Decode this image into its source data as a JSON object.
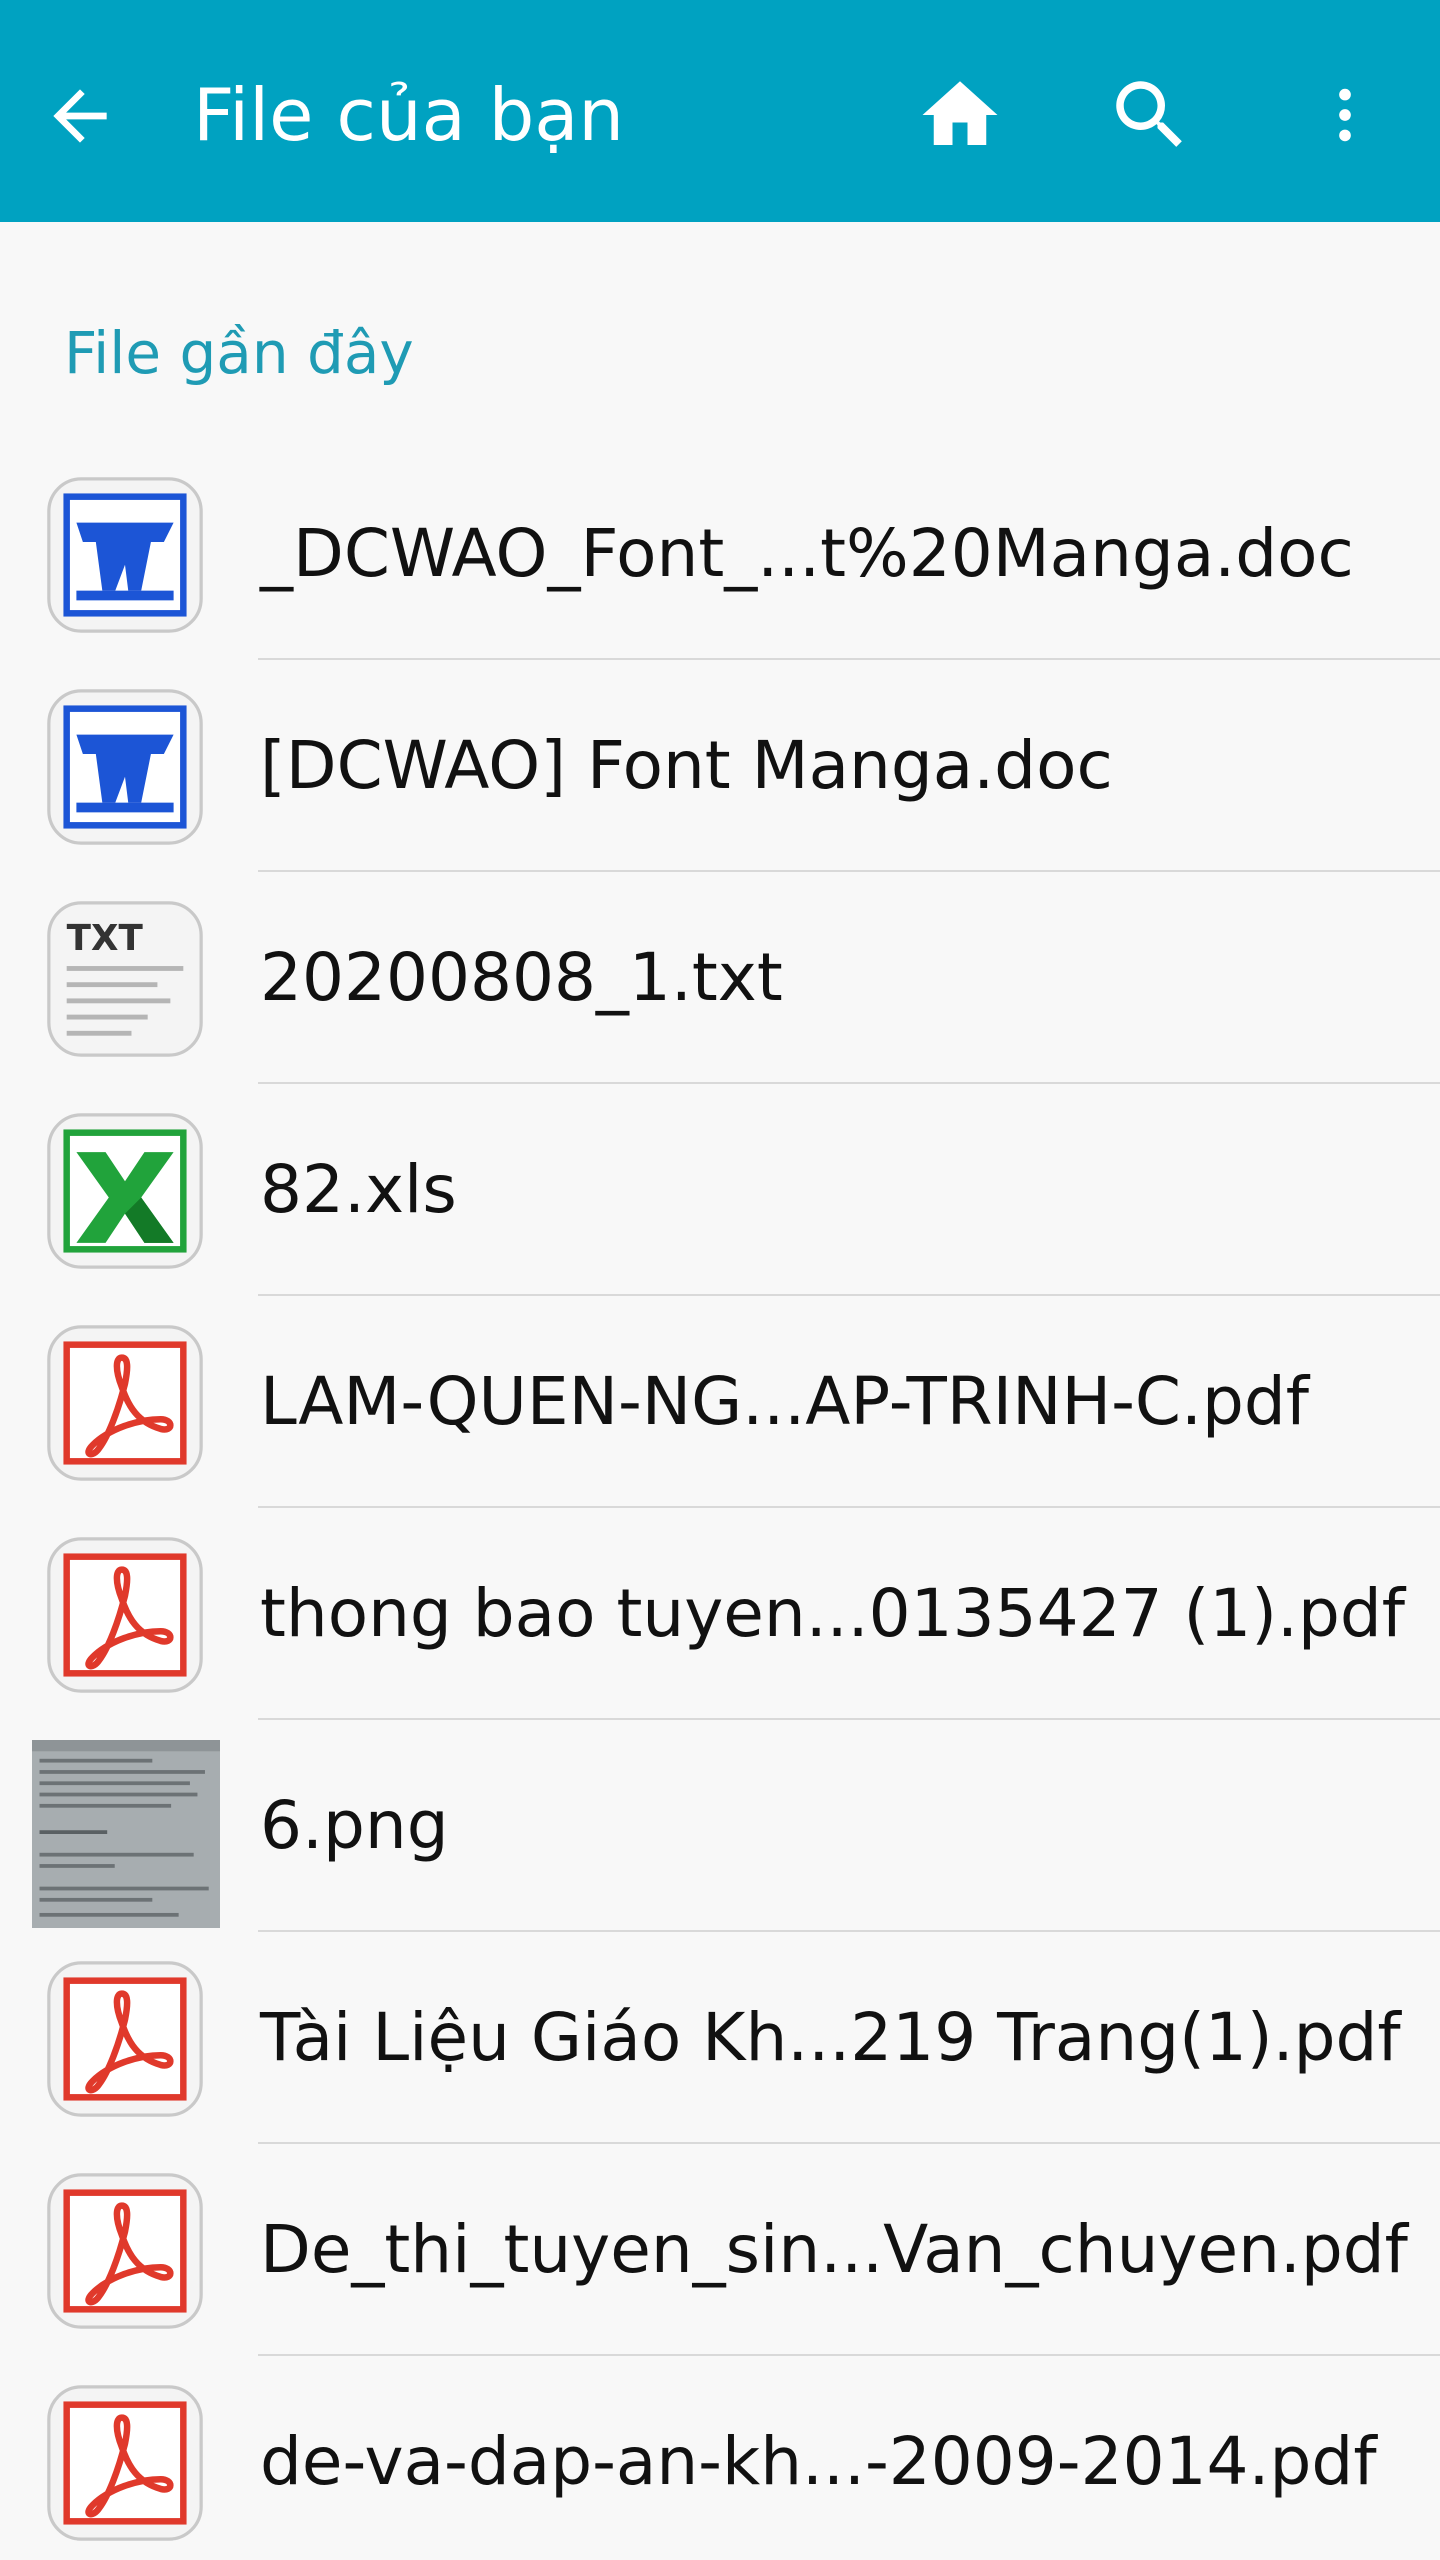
{
  "appbar": {
    "title": "File của bạn",
    "background": "#00a2c1",
    "icons": [
      "back-arrow-icon",
      "home-icon",
      "search-icon",
      "more-vert-icon"
    ]
  },
  "section": {
    "label": "File gần đây",
    "color": "#1f9bb4"
  },
  "files": [
    {
      "name": "_DCWAO_Font_...t%20Manga.doc",
      "type": "word"
    },
    {
      "name": "[DCWAO] Font Manga.doc",
      "type": "word"
    },
    {
      "name": "20200808_1.txt",
      "type": "txt",
      "icon_label": "TXT"
    },
    {
      "name": "82.xls",
      "type": "excel"
    },
    {
      "name": "LAM-QUEN-NG...AP-TRINH-C.pdf",
      "type": "pdf"
    },
    {
      "name": "thong bao tuyen...0135427 (1).pdf",
      "type": "pdf"
    },
    {
      "name": "6.png",
      "type": "image"
    },
    {
      "name": "Tài Liệu Giáo Kh...219 Trang(1).pdf",
      "type": "pdf"
    },
    {
      "name": "De_thi_tuyen_sin...Van_chuyen.pdf",
      "type": "pdf"
    },
    {
      "name": "de-va-dap-an-kh...-2009-2014.pdf",
      "type": "pdf"
    }
  ],
  "colors": {
    "word": "#1c55d6",
    "excel": "#21a33b",
    "pdf": "#e0392b",
    "txt": "#666666"
  }
}
